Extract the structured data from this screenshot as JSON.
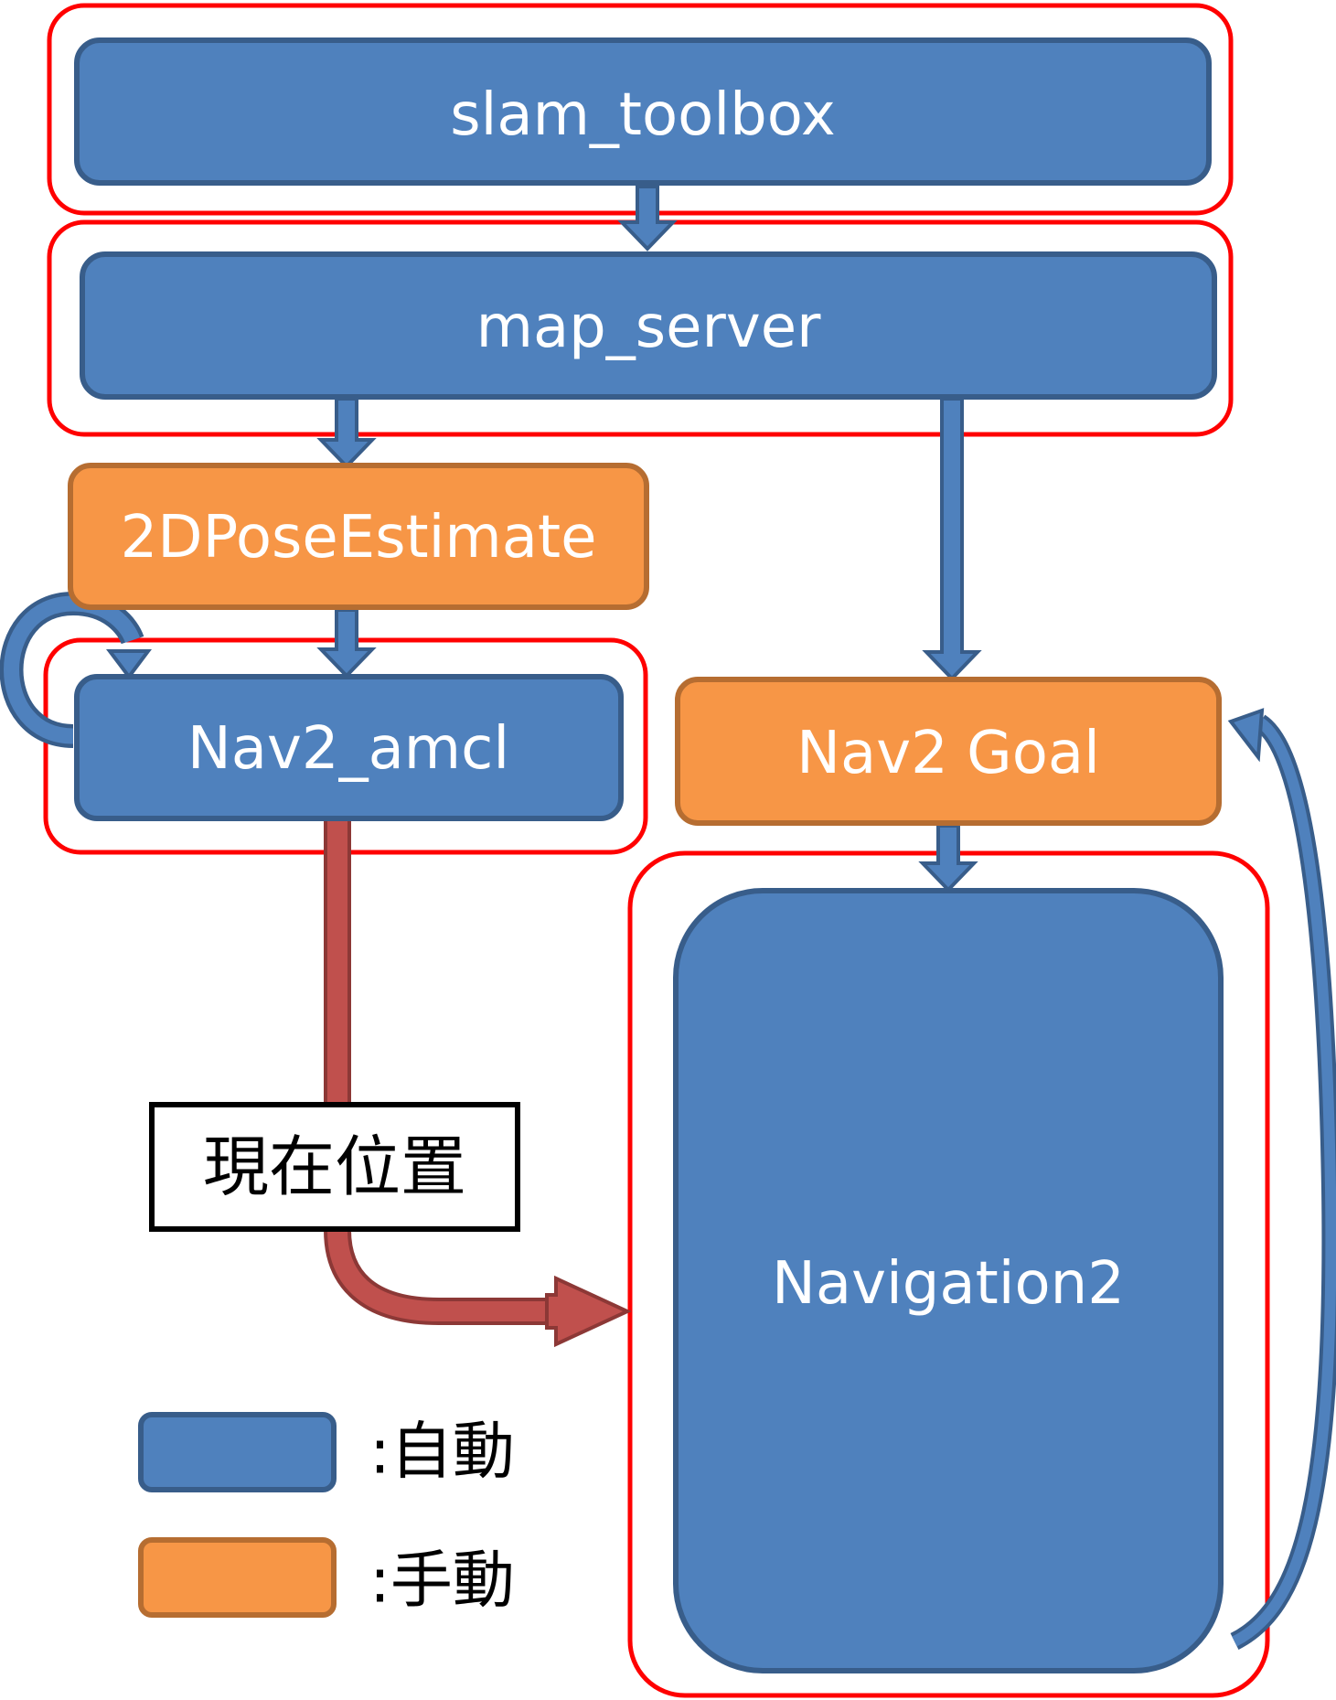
{
  "nodes": {
    "slam_toolbox": "slam_toolbox",
    "map_server": "map_server",
    "pose_estimate": "2DPoseEstimate",
    "amcl": "Nav2_amcl",
    "goal": "Nav2 Goal",
    "navigation": "Navigation2"
  },
  "edge_label": "現在位置",
  "legend": {
    "auto": ":自動",
    "manual": ":手動"
  },
  "colors": {
    "auto_fill": "#4f81bd",
    "auto_stroke": "#385d8a",
    "manual_fill": "#f79646",
    "manual_stroke": "#b66d31",
    "highlight": "#ff0000",
    "position_arrow_fill": "#c0504d",
    "position_arrow_stroke": "#8c3836"
  }
}
